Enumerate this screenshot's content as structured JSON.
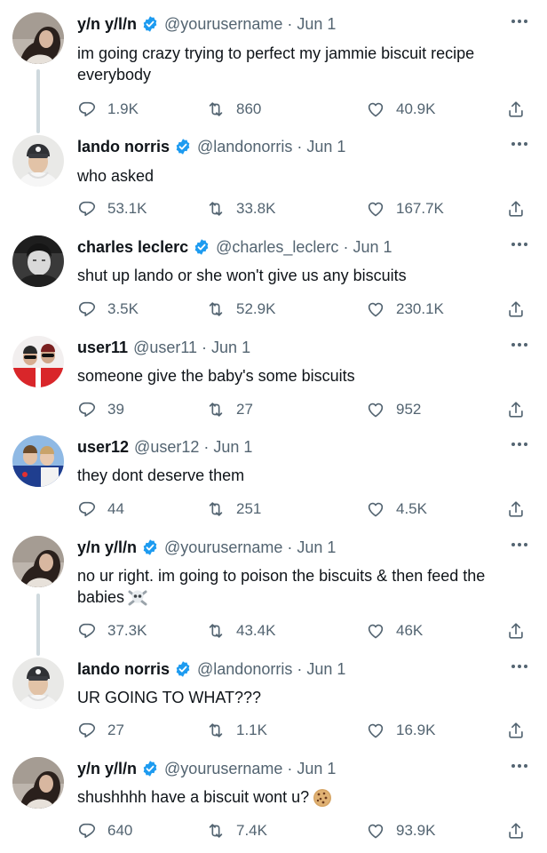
{
  "tweets": [
    {
      "name": "y/n y/l/n",
      "verified": true,
      "handle": "@yourusername",
      "dot": "·",
      "date": "Jun 1",
      "text": "im going crazy trying to perfect my jammie biscuit recipe everybody",
      "replies": "1.9K",
      "retweets": "860",
      "likes": "40.9K",
      "avatar": "dark-hair-woman"
    },
    {
      "name": "lando norris",
      "verified": true,
      "handle": "@landonorris",
      "dot": "·",
      "date": "Jun 1",
      "text": "who asked",
      "replies": "53.1K",
      "retweets": "33.8K",
      "likes": "167.7K",
      "avatar": "cap-man"
    },
    {
      "name": "charles leclerc",
      "verified": true,
      "handle": "@charles_leclerc",
      "dot": "·",
      "date": "Jun 1",
      "text": "shut up lando or she won't give us any biscuits",
      "replies": "3.5K",
      "retweets": "52.9K",
      "likes": "230.1K",
      "avatar": "bw-portrait"
    },
    {
      "name": "user11",
      "verified": false,
      "handle": "@user11",
      "dot": "·",
      "date": "Jun 1",
      "text": "someone give the baby's some biscuits",
      "replies": "39",
      "retweets": "27",
      "likes": "952",
      "avatar": "red-racers"
    },
    {
      "name": "user12",
      "verified": false,
      "handle": "@user12",
      "dot": "·",
      "date": "Jun 1",
      "text": "they dont deserve them",
      "replies": "44",
      "retweets": "251",
      "likes": "4.5K",
      "avatar": "blue-racers"
    },
    {
      "name": "y/n y/l/n",
      "verified": true,
      "handle": "@yourusername",
      "dot": "·",
      "date": "Jun 1",
      "text": "no ur right. im going to poison the biscuits & then feed the babies",
      "emoji": "skull-crossbones-emoji",
      "replies": "37.3K",
      "retweets": "43.4K",
      "likes": "46K",
      "avatar": "dark-hair-woman"
    },
    {
      "name": "lando norris",
      "verified": true,
      "handle": "@landonorris",
      "dot": "·",
      "date": "Jun 1",
      "text": "UR GOING TO WHAT???",
      "replies": "27",
      "retweets": "1.1K",
      "likes": "16.9K",
      "avatar": "cap-man"
    },
    {
      "name": "y/n y/l/n",
      "verified": true,
      "handle": "@yourusername",
      "dot": "·",
      "date": "Jun 1",
      "text": "shushhhh have a biscuit wont u?",
      "emoji": "cookie-emoji",
      "replies": "640",
      "retweets": "7.4K",
      "likes": "93.9K",
      "avatar": "dark-hair-woman"
    }
  ],
  "icons": {
    "reply": "reply-icon",
    "retweet": "retweet-icon",
    "like": "like-icon",
    "share": "share-icon",
    "more": "more-icon",
    "verified": "verified-badge-icon"
  },
  "colors": {
    "text": "#0f1419",
    "secondary": "#536471",
    "verified": "#1d9bf0",
    "thread_line": "#cfd9de"
  }
}
